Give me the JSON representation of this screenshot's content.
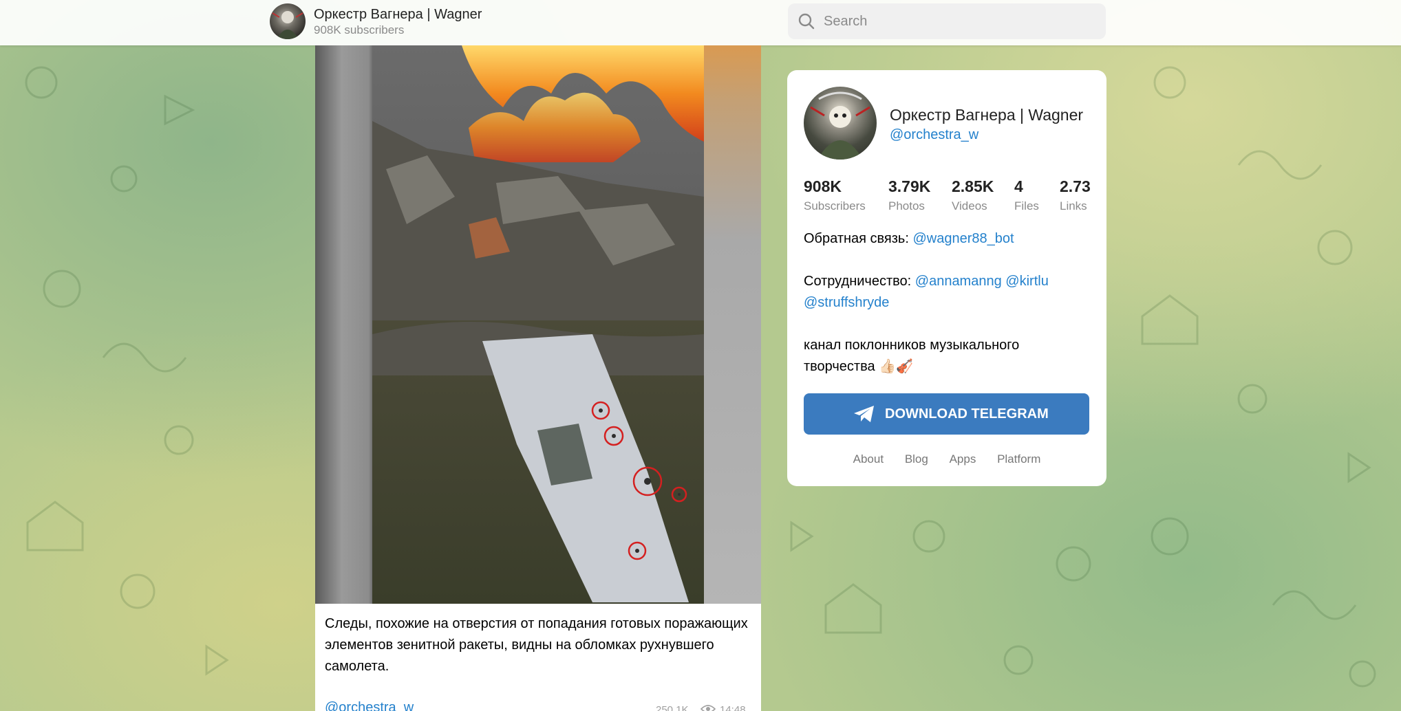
{
  "header": {
    "channel_title": "Оркестр Вагнера | Wagner",
    "subscribers": "908K subscribers",
    "search_placeholder": "Search"
  },
  "post": {
    "caption": "Следы, похожие на отверстия от попадания готовых поражающих элементов зенитной ракеты, видны на обломках рухнувшего самолета.",
    "author": "@orchestra_w",
    "views": "250.1K",
    "time": "14:48"
  },
  "channel": {
    "name": "Оркестр Вагнера | Wagner",
    "handle": "@orchestra_w",
    "counters": [
      {
        "value": "908K",
        "label": "Subscribers"
      },
      {
        "value": "3.79K",
        "label": "Photos"
      },
      {
        "value": "2.85K",
        "label": "Videos"
      },
      {
        "value": "4",
        "label": "Files"
      },
      {
        "value": "2.73",
        "label": "Links"
      }
    ],
    "feedback_label": "Обратная связь:",
    "feedback_link": "@wagner88_bot",
    "coop_label": "Сотрудничество:",
    "coop_link_1": "@annamanng",
    "coop_link_2": "@kirtlu",
    "coop_link_3": "@struffshryde",
    "about_text": "канал поклонников музыкального творчества 👍🏻🎻",
    "download_label": "DOWNLOAD TELEGRAM",
    "footer_links": [
      "About",
      "Blog",
      "Apps",
      "Platform"
    ]
  },
  "colors": {
    "link": "#2481cc",
    "button": "#3b7bbf"
  }
}
